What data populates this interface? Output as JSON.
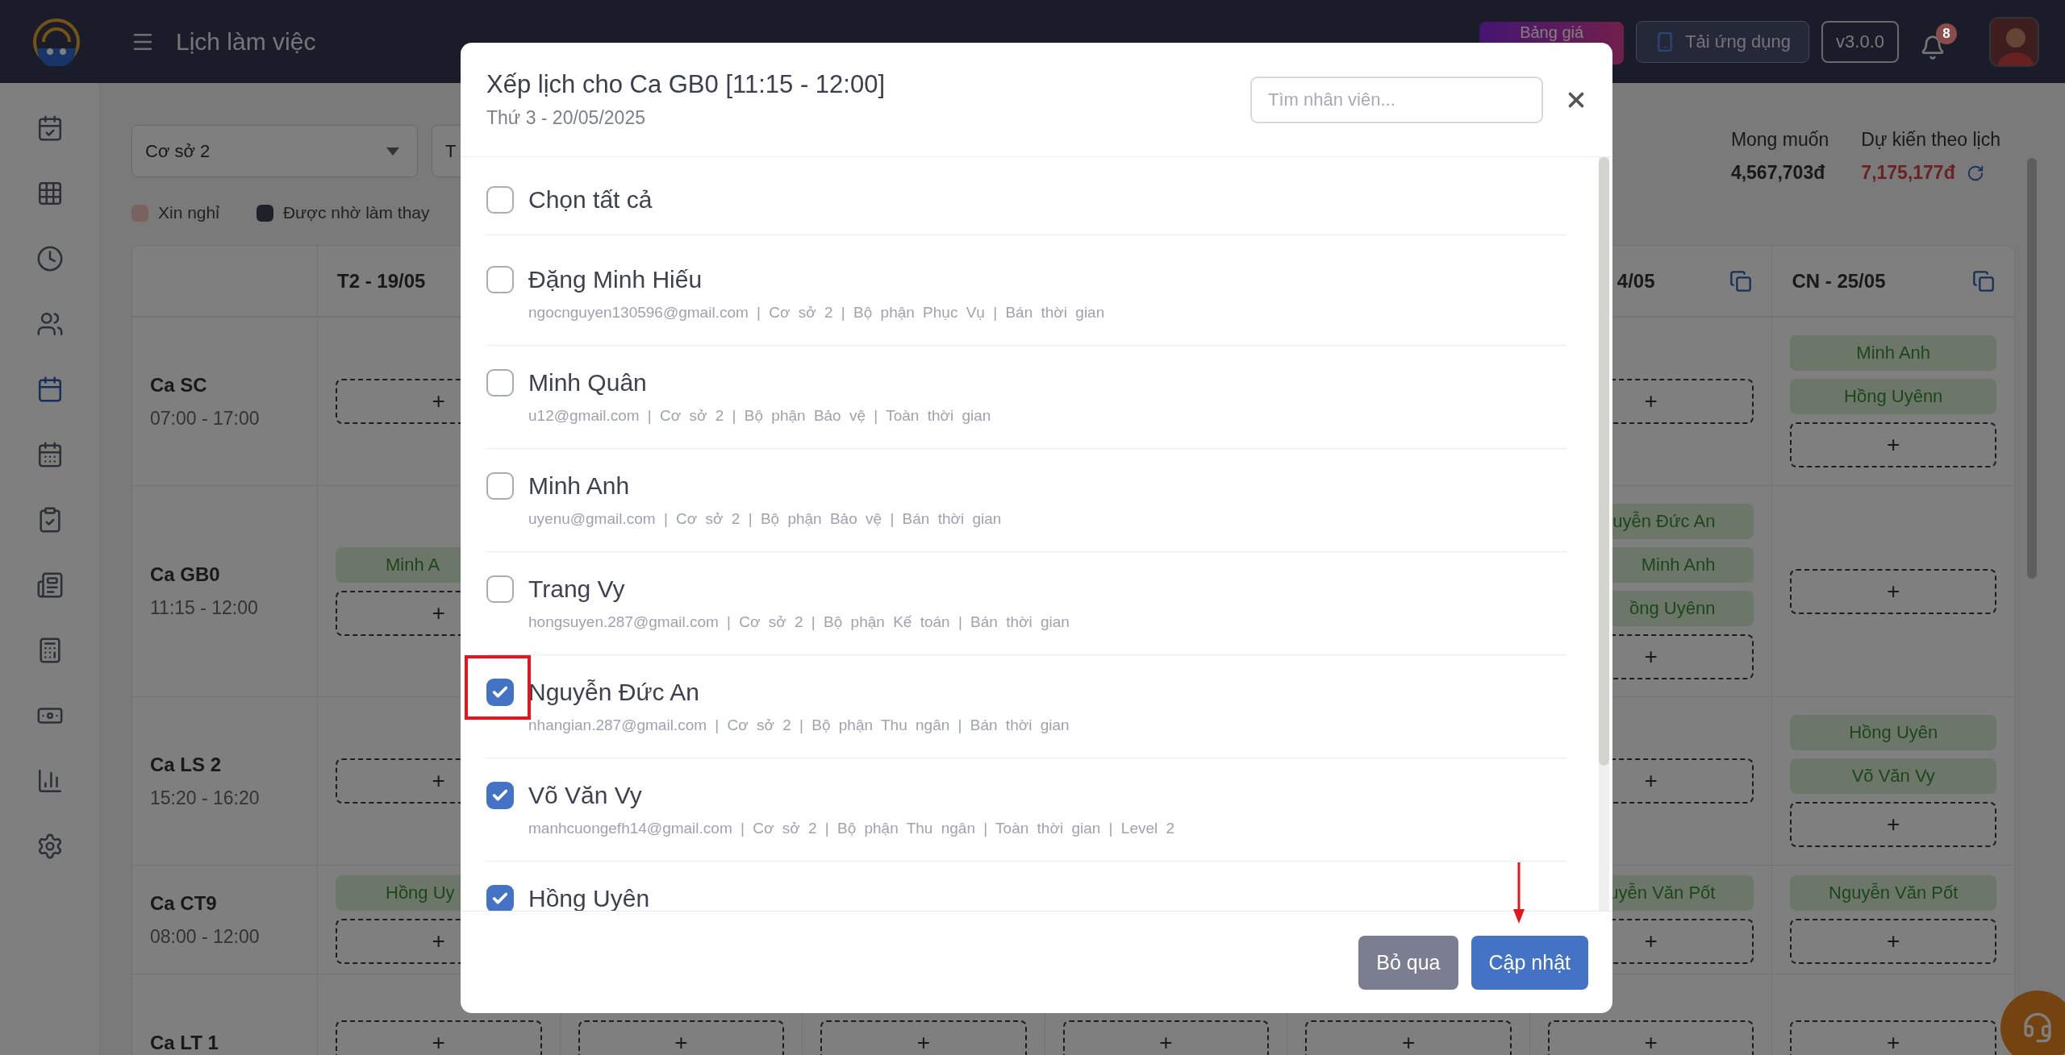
{
  "topbar": {
    "title": "Lịch làm việc",
    "pricing_button": "Bảng giá",
    "app_button": "Tải ứng dụng",
    "version": "v3.0.0",
    "notification_count": "8"
  },
  "sidebar": {
    "items": [
      {
        "selected": false
      },
      {
        "selected": false
      },
      {
        "selected": false
      },
      {
        "selected": false
      },
      {
        "selected": true
      },
      {
        "selected": false
      },
      {
        "selected": false
      },
      {
        "selected": false
      },
      {
        "selected": false
      },
      {
        "selected": false
      },
      {
        "selected": false
      },
      {
        "selected": false
      }
    ]
  },
  "filters": {
    "branch_select": "Cơ sở 2",
    "second_select": "T"
  },
  "legend": [
    {
      "label": "Xin nghỉ",
      "color": "#7a6261"
    },
    {
      "label": "Được nhờ làm thay",
      "color": "#1e2129"
    }
  ],
  "summary": [
    {
      "label": "Mong muốn",
      "value": "4,567,703đ",
      "kind": "plain"
    },
    {
      "label": "Dự kiến theo lịch",
      "value": "7,175,177đ",
      "kind": "projected"
    }
  ],
  "schedule": {
    "columns": [
      {
        "label": "T2 - 19/05"
      },
      null,
      null,
      null,
      null,
      {
        "label": "4/05",
        "copy_icon": true
      },
      {
        "label": "CN - 25/05",
        "copy_icon": true
      }
    ],
    "rows": [
      {
        "name": "Ca SC",
        "time": "07:00 - 17:00",
        "cells": [
          {
            "add": "+"
          },
          null,
          null,
          null,
          null,
          {
            "add": "+"
          },
          {
            "chips": [
              "Minh Anh",
              "Hồng Uyênn"
            ],
            "add": "+"
          }
        ]
      },
      {
        "name": "Ca GB0",
        "time": "11:15 - 12:00",
        "cells": [
          {
            "chips": [
              "Minh A"
            ],
            "add": "+"
          },
          null,
          null,
          null,
          null,
          {
            "chips": [
              "uyễn Đức An",
              "Minh Anh",
              "ồng Uyênn"
            ],
            "add": "+"
          },
          {
            "add": "+"
          }
        ]
      },
      {
        "name": "Ca LS 2",
        "time": "15:20 - 16:20",
        "cells": [
          {
            "add": "+"
          },
          null,
          null,
          null,
          null,
          {
            "add": "+"
          },
          {
            "chips": [
              "Hồng Uyên",
              "Võ Văn Vy"
            ],
            "add": "+"
          }
        ]
      },
      {
        "name": "Ca CT9",
        "time": "08:00 - 12:00",
        "cells": [
          {
            "chips": [
              "Hồng Uy"
            ],
            "add": "+"
          },
          null,
          null,
          null,
          null,
          {
            "chips": [
              "uyễn Văn Pốt"
            ],
            "add": "+"
          },
          {
            "chips": [
              "Nguyễn Văn Pốt"
            ],
            "add": "+"
          }
        ]
      },
      {
        "name": "Ca LT 1",
        "cells": [
          {
            "add": "+"
          },
          {
            "add": "+"
          },
          {
            "add": "+"
          },
          {
            "add": "+"
          },
          {
            "add": "+"
          },
          {
            "add": "+"
          },
          {
            "add": "+"
          }
        ]
      }
    ]
  },
  "modal": {
    "title": "Xếp lịch cho Ca GB0 [11:15 - 12:00]",
    "subtitle": "Thứ 3 - 20/05/2025",
    "search_placeholder": "Tìm nhân viên...",
    "select_all": {
      "label": "Chọn tất cả",
      "checked": false
    },
    "employees": [
      {
        "name": "Đặng Minh Hiếu",
        "details": "ngocnguyen130596@gmail.com | Cơ sở 2 | Bộ phận Phục Vụ | Bán thời gian",
        "checked": false
      },
      {
        "name": "Minh Quân",
        "details": "u12@gmail.com | Cơ sở 2 | Bộ phận Bảo vệ | Toàn thời gian",
        "checked": false
      },
      {
        "name": "Minh Anh",
        "details": "uyenu@gmail.com | Cơ sở 2 | Bộ phận Bảo vệ | Bán thời gian",
        "checked": false
      },
      {
        "name": "Trang Vy",
        "details": "hongsuyen.287@gmail.com | Cơ sở 2 | Bộ phận Kế toán | Bán thời gian",
        "checked": false
      },
      {
        "name": "Nguyễn Đức An",
        "details": "nhangian.287@gmail.com | Cơ sở 2 | Bộ phận Thu ngân | Bán thời gian",
        "checked": true
      },
      {
        "name": "Võ Văn Vy",
        "details": "manhcuongefh14@gmail.com | Cơ sở 2 | Bộ phận Thu ngân | Toàn thời gian | Level 2",
        "checked": true
      },
      {
        "name": "Hồng Uyên",
        "checked": true
      }
    ],
    "buttons": [
      {
        "label": "Bỏ qua",
        "kind": "secondary"
      },
      {
        "label": "Cập nhật",
        "kind": "primary"
      }
    ]
  }
}
